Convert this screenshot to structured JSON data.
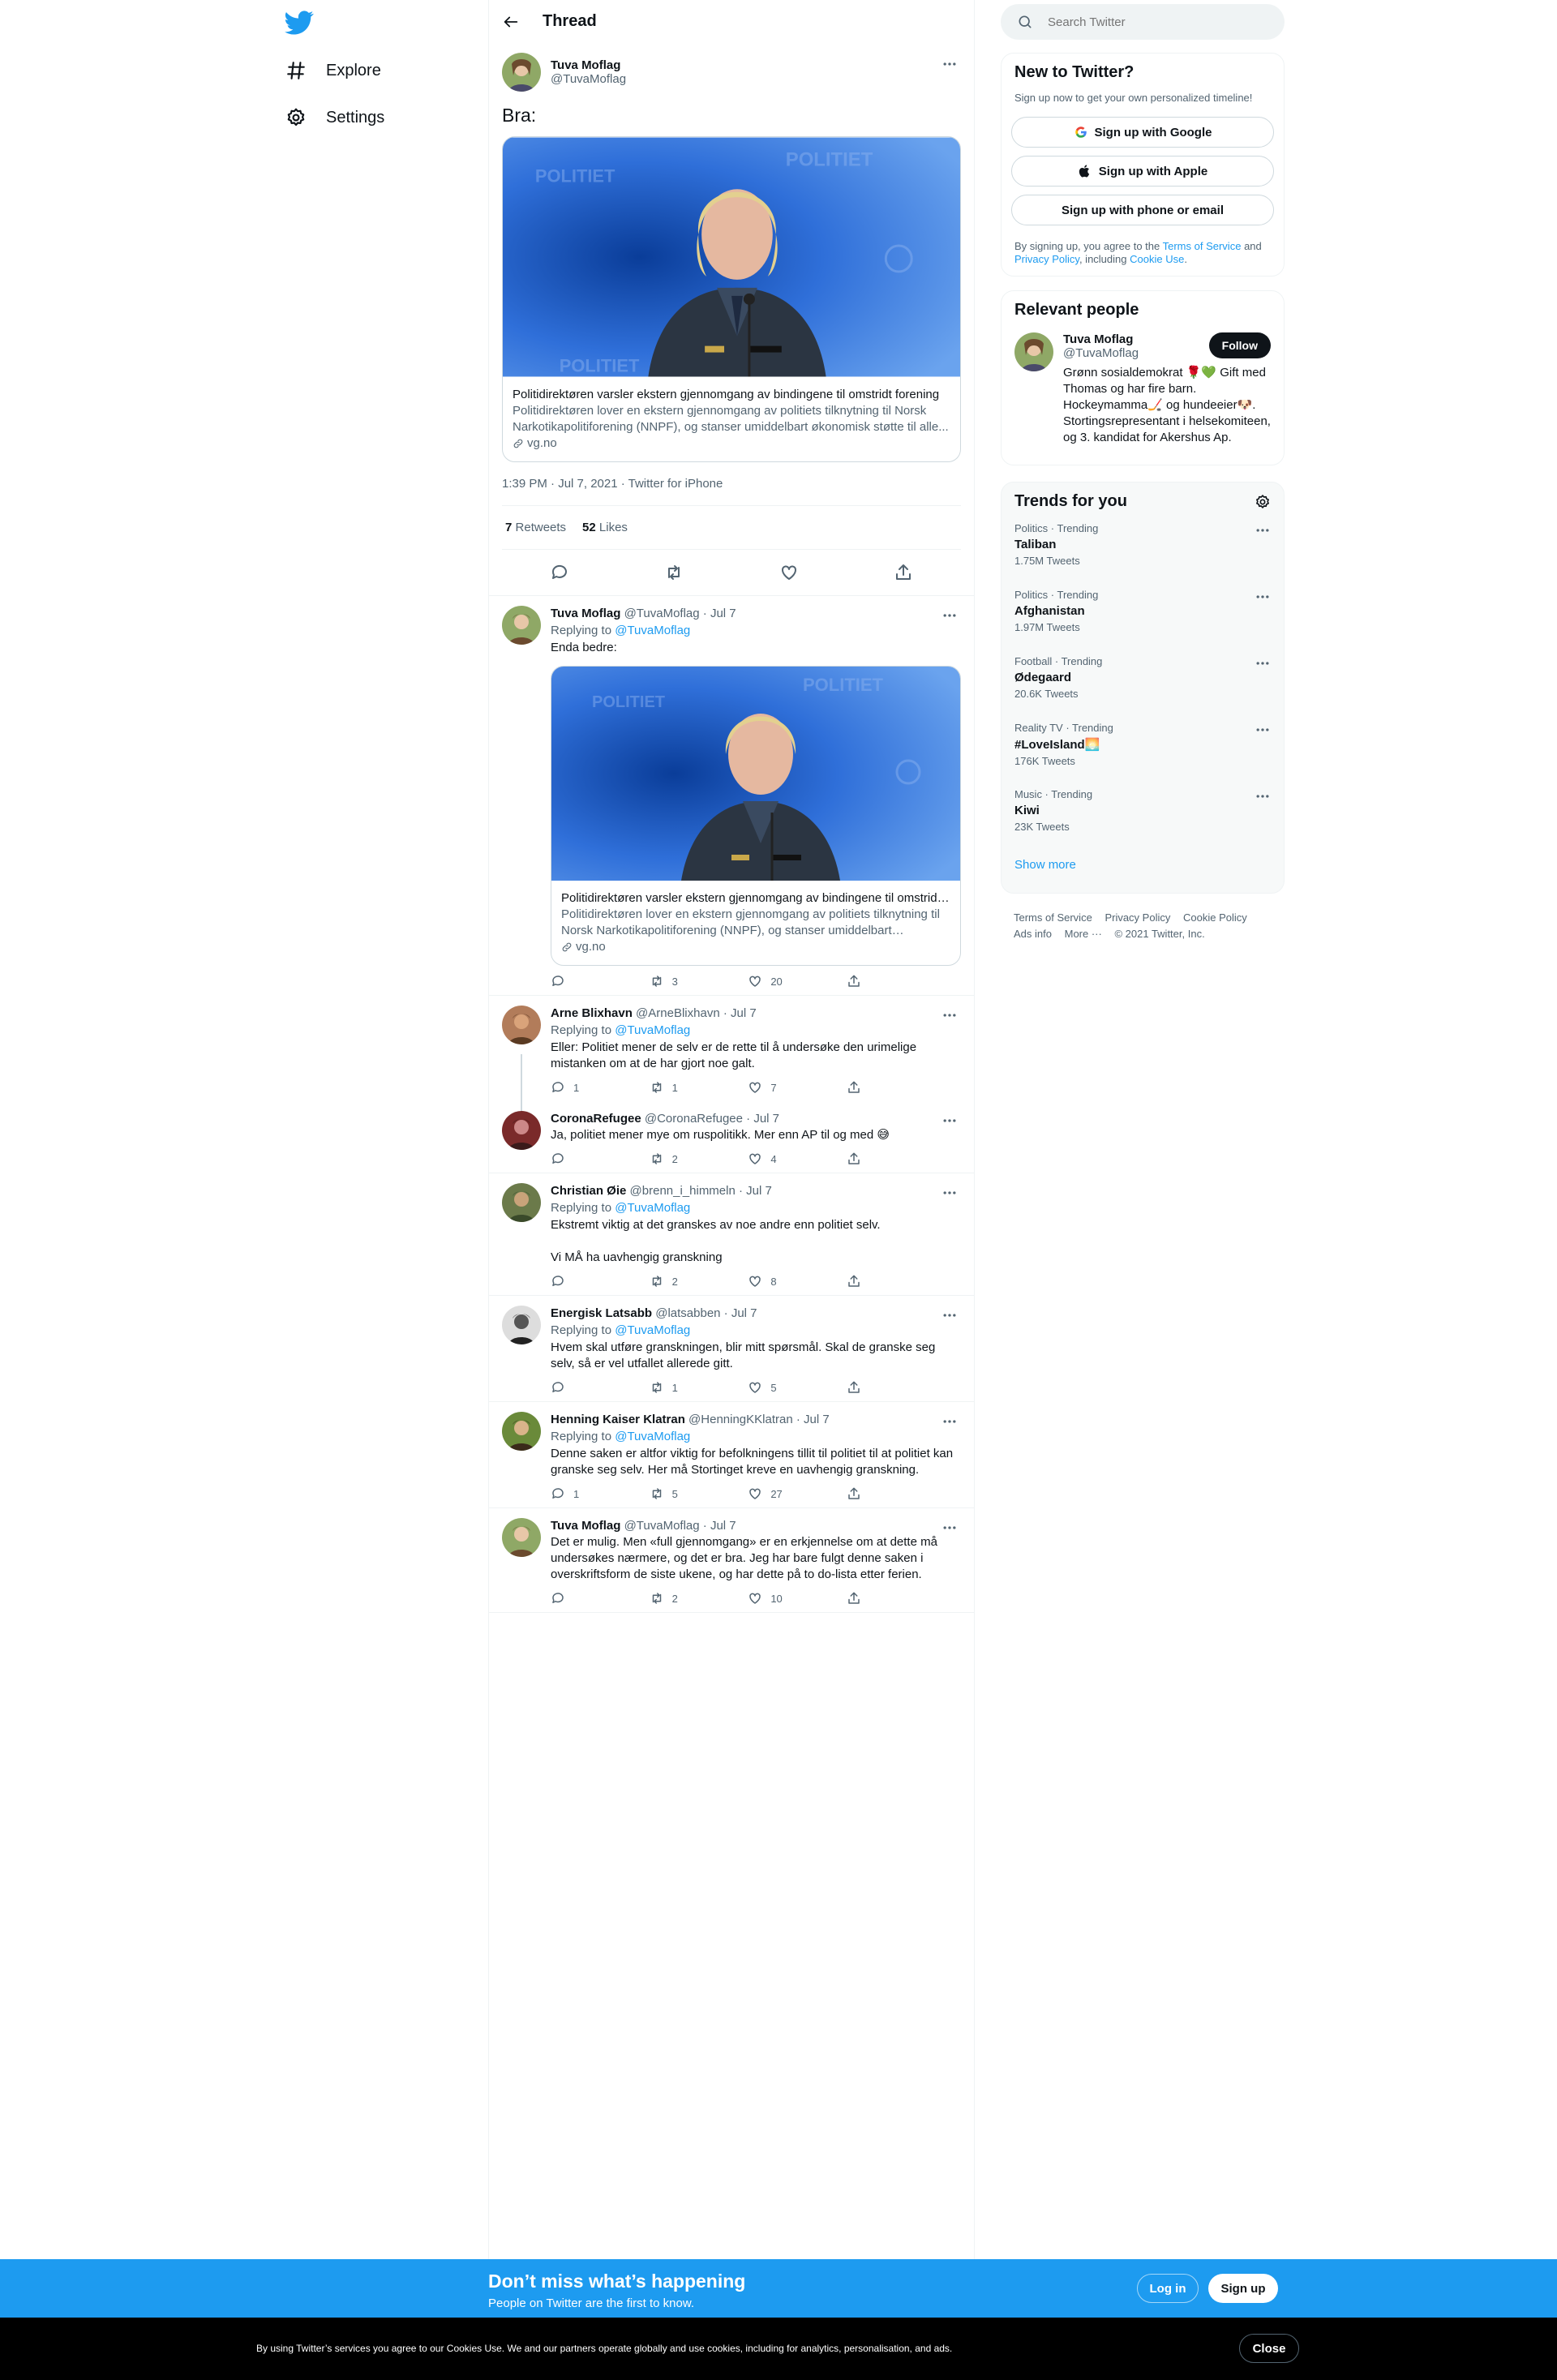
{
  "colors": {
    "brand": "#1d9bf0",
    "text": "#0f1419",
    "secondary": "#536471"
  },
  "nav": {
    "explore": "Explore",
    "settings": "Settings"
  },
  "header": {
    "title": "Thread"
  },
  "focal": {
    "name": "Tuva Moflag",
    "handle": "@TuvaMoflag",
    "text": "Bra:",
    "card": {
      "title": "Politidirektøren varsler ekstern gjennomgang av bindingene til omstridt forening",
      "desc": "Politidirektøren lover en ekstern gjennomgang av politiets tilknytning til Norsk Narkotikapolitiforening (NNPF), og stanser umiddelbart økonomisk støtte til alle...",
      "domain": "vg.no",
      "img_left_text": "POLITIET",
      "img_right_text": "POLITIET",
      "img_bottom_text": "POLITIET"
    },
    "timestamp": "1:39 PM · Jul 7, 2021 · Twitter for iPhone",
    "retweets_count": "7",
    "retweets_label": "Retweets",
    "likes_count": "52",
    "likes_label": "Likes"
  },
  "tweets": [
    {
      "name": "Tuva Moflag",
      "handle": "@TuvaMoflag",
      "date": "· Jul 7",
      "reply_prefix": "Replying to",
      "reply_to": "@TuvaMoflag",
      "text": "Enda bedre:",
      "card": {
        "title": "Politidirektøren varsler ekstern gjennomgang av bindingene til omstridt forening",
        "desc": "Politidirektøren lover en ekstern gjennomgang av politiets tilknytning til Norsk Narkotikapolitiforening (NNPF), og stanser umiddelbart økonomisk støtte til alle...",
        "domain": "vg.no",
        "img_left_text": "POLITIET",
        "img_right_text": "POLITIET"
      },
      "replies": "",
      "retweets": "3",
      "likes": "20"
    },
    {
      "name": "Arne Blixhavn",
      "handle": "@ArneBlixhavn",
      "date": "· Jul 7",
      "reply_prefix": "Replying to",
      "reply_to": "@TuvaMoflag",
      "text": "Eller: Politiet mener de selv er de rette til å undersøke den urimelige mistanken om at de har gjort noe galt.",
      "replies": "1",
      "retweets": "1",
      "likes": "7"
    },
    {
      "name": "CoronaRefugee",
      "handle": "@CoronaRefugee",
      "date": "· Jul 7",
      "text": "Ja, politiet mener mye om ruspolitikk. Mer enn AP til og med 😅",
      "replies": "",
      "retweets": "2",
      "likes": "4"
    },
    {
      "name": "Christian Øie",
      "handle": "@brenn_i_himmeln",
      "date": "· Jul 7",
      "reply_prefix": "Replying to",
      "reply_to": "@TuvaMoflag",
      "text": "Ekstremt viktig at det granskes av noe andre enn politiet selv.\n\nVi MÅ ha uavhengig granskning",
      "replies": "",
      "retweets": "2",
      "likes": "8"
    },
    {
      "name": "Energisk Latsabb",
      "handle": "@latsabben",
      "date": "· Jul 7",
      "reply_prefix": "Replying to",
      "reply_to": "@TuvaMoflag",
      "text": "Hvem skal utføre granskningen, blir mitt spørsmål. Skal de granske seg selv, så er vel utfallet allerede gitt.",
      "replies": "",
      "retweets": "1",
      "likes": "5"
    },
    {
      "name": "Henning Kaiser Klatran",
      "handle": "@HenningKKlatran",
      "date": "· Jul 7",
      "reply_prefix": "Replying to",
      "reply_to": "@TuvaMoflag",
      "text": "Denne saken er altfor viktig for befolkningens tillit til politiet til at politiet kan granske seg selv. Her må Stortinget kreve en uavhengig granskning.",
      "replies": "1",
      "retweets": "5",
      "likes": "27"
    },
    {
      "name": "Tuva Moflag",
      "handle": "@TuvaMoflag",
      "date": "· Jul 7",
      "text": "Det er mulig. Men «full gjennomgang» er en erkjennelse om at dette må undersøkes nærmere, og det er bra. Jeg har bare fulgt denne saken i overskriftsform de siste ukene, og har dette på to do-lista etter ferien.",
      "replies": "",
      "retweets": "2",
      "likes": "10"
    }
  ],
  "search": {
    "placeholder": "Search Twitter"
  },
  "new_to_twitter": {
    "title": "New to Twitter?",
    "subtitle": "Sign up now to get your own personalized timeline!",
    "google": "Sign up with Google",
    "apple": "Sign up with Apple",
    "phone": "Sign up with phone or email",
    "legal_prefix": "By signing up, you agree to the",
    "tos": "Terms of Service",
    "and": "and",
    "privacy": "Privacy Policy",
    "including": ", including",
    "cookie": "Cookie Use",
    "period": "."
  },
  "relevant": {
    "title": "Relevant people",
    "name": "Tuva Moflag",
    "handle": "@TuvaMoflag",
    "follow": "Follow",
    "bio": "Grønn sosialdemokrat 🌹💚 Gift med Thomas og har fire barn. Hockeymamma🏒 og hundeeier🐶. Stortingsrepresentant i helsekomiteen, og 3. kandidat for Akershus Ap."
  },
  "trends": {
    "title": "Trends for you",
    "show_more": "Show more",
    "items": [
      {
        "context": "Politics · Trending",
        "name": "Taliban",
        "count": "1.75M Tweets"
      },
      {
        "context": "Politics · Trending",
        "name": "Afghanistan",
        "count": "1.97M Tweets"
      },
      {
        "context": "Football · Trending",
        "name": "Ødegaard",
        "count": "20.6K Tweets"
      },
      {
        "context": "Reality TV · Trending",
        "name": "#LoveIsland🌅",
        "count": "176K Tweets"
      },
      {
        "context": "Music · Trending",
        "name": "Kiwi",
        "count": "23K Tweets"
      }
    ]
  },
  "footer": {
    "tos": "Terms of Service",
    "privacy": "Privacy Policy",
    "cookie": "Cookie Policy",
    "ads": "Ads info",
    "more": "More ···",
    "copyright": "© 2021 Twitter, Inc."
  },
  "banner": {
    "title": "Don’t miss what’s happening",
    "subtitle": "People on Twitter are the first to know.",
    "login": "Log in",
    "signup": "Sign up"
  },
  "cookie": {
    "text": "By using Twitter’s services you agree to our Cookies Use. We and our partners operate globally and use cookies, including for analytics, personalisation, and ads.",
    "close": "Close"
  }
}
